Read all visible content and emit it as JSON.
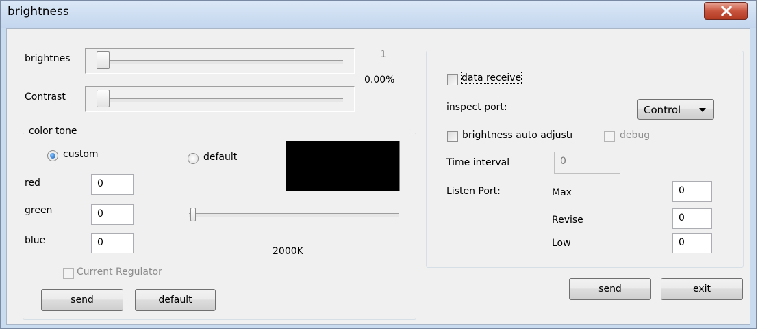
{
  "window": {
    "title": "brightness"
  },
  "brightness": {
    "label": "brightnes",
    "value_text": "1",
    "percent_text": "0.00%",
    "level": 0
  },
  "contrast": {
    "label": "Contrast",
    "level": 0
  },
  "color_tone": {
    "legend": "color tone",
    "custom_label": "custom",
    "default_label": "default",
    "selected": "custom",
    "swatch_color": "#000000",
    "red_label": "red",
    "red_value": "0",
    "green_label": "green",
    "green_value": "0",
    "blue_label": "blue",
    "blue_value": "0",
    "temperature_text": "2000K",
    "temperature_level": 0,
    "current_regulator_label": "Current Regulator",
    "send_label": "send",
    "default_button_label": "default"
  },
  "right": {
    "data_receive_label": "data receive",
    "inspect_port_label": "inspect port:",
    "inspect_port_value": "Control",
    "auto_adjust_label": "brightness auto adjustı",
    "debug_label": "debug",
    "time_interval_label": "Time interval",
    "time_interval_value": "0",
    "listen_port_label": "Listen Port:",
    "max_label": "Max",
    "max_value": "0",
    "revise_label": "Revise",
    "revise_value": "0",
    "low_label": "Low",
    "low_value": "0",
    "send_label": "send",
    "exit_label": "exit"
  }
}
